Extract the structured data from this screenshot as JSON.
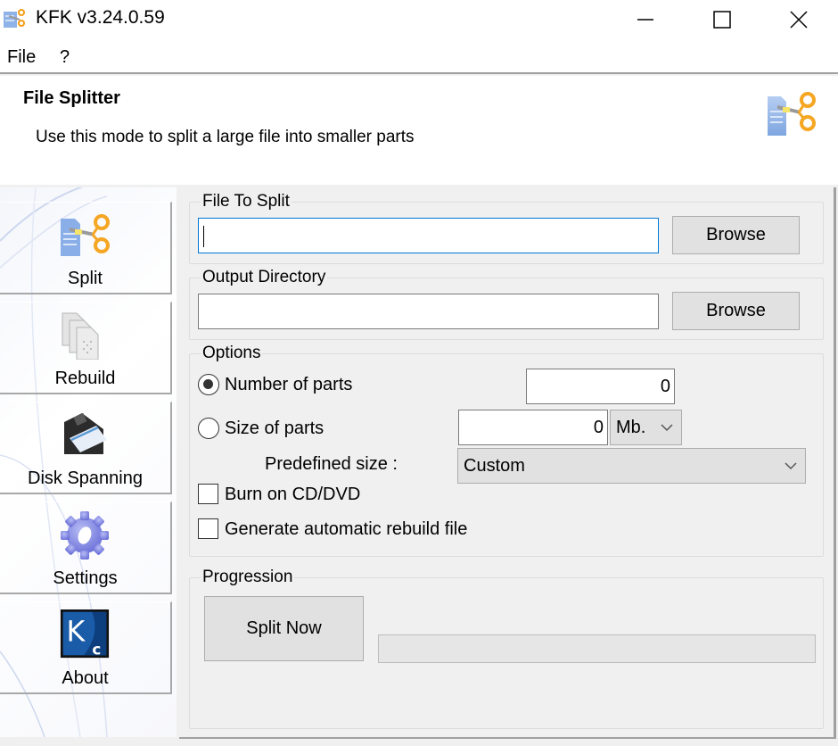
{
  "window": {
    "title": "KFK v3.24.0.59",
    "app_icon": "file-scissors-icon",
    "controls": {
      "minimize": "minimize-icon",
      "maximize": "maximize-icon",
      "close": "close-icon"
    }
  },
  "menu": {
    "items": [
      {
        "label": "File"
      },
      {
        "label": "?"
      }
    ]
  },
  "banner": {
    "title": "File Splitter",
    "subtitle": "Use this mode to split a large file into smaller parts",
    "icon": "file-scissors-icon"
  },
  "sidebar": {
    "items": [
      {
        "label": "Split",
        "icon": "file-scissors-icon",
        "active": true
      },
      {
        "label": "Rebuild",
        "icon": "stacked-documents-icon"
      },
      {
        "label": "Disk Spanning",
        "icon": "floppy-disk-icon"
      },
      {
        "label": "Settings",
        "icon": "gear-icon"
      },
      {
        "label": "About",
        "icon": "kc-logo-icon"
      }
    ]
  },
  "file_to_split": {
    "title": "File To Split",
    "value": "",
    "browse_label": "Browse"
  },
  "output_directory": {
    "title": "Output Directory",
    "value": "",
    "browse_label": "Browse"
  },
  "options": {
    "title": "Options",
    "number_of_parts": {
      "label": "Number of parts",
      "checked": true,
      "value": "0"
    },
    "size_of_parts": {
      "label": "Size of parts",
      "checked": false,
      "value": "0",
      "unit": "Mb."
    },
    "predefined_size": {
      "label": "Predefined size :",
      "value": "Custom"
    },
    "burn_cd": {
      "label": "Burn on CD/DVD",
      "checked": false
    },
    "generate_rebuild": {
      "label": "Generate automatic rebuild file",
      "checked": false
    }
  },
  "progression": {
    "title": "Progression",
    "split_now_label": "Split Now",
    "progress_percent": 0
  }
}
